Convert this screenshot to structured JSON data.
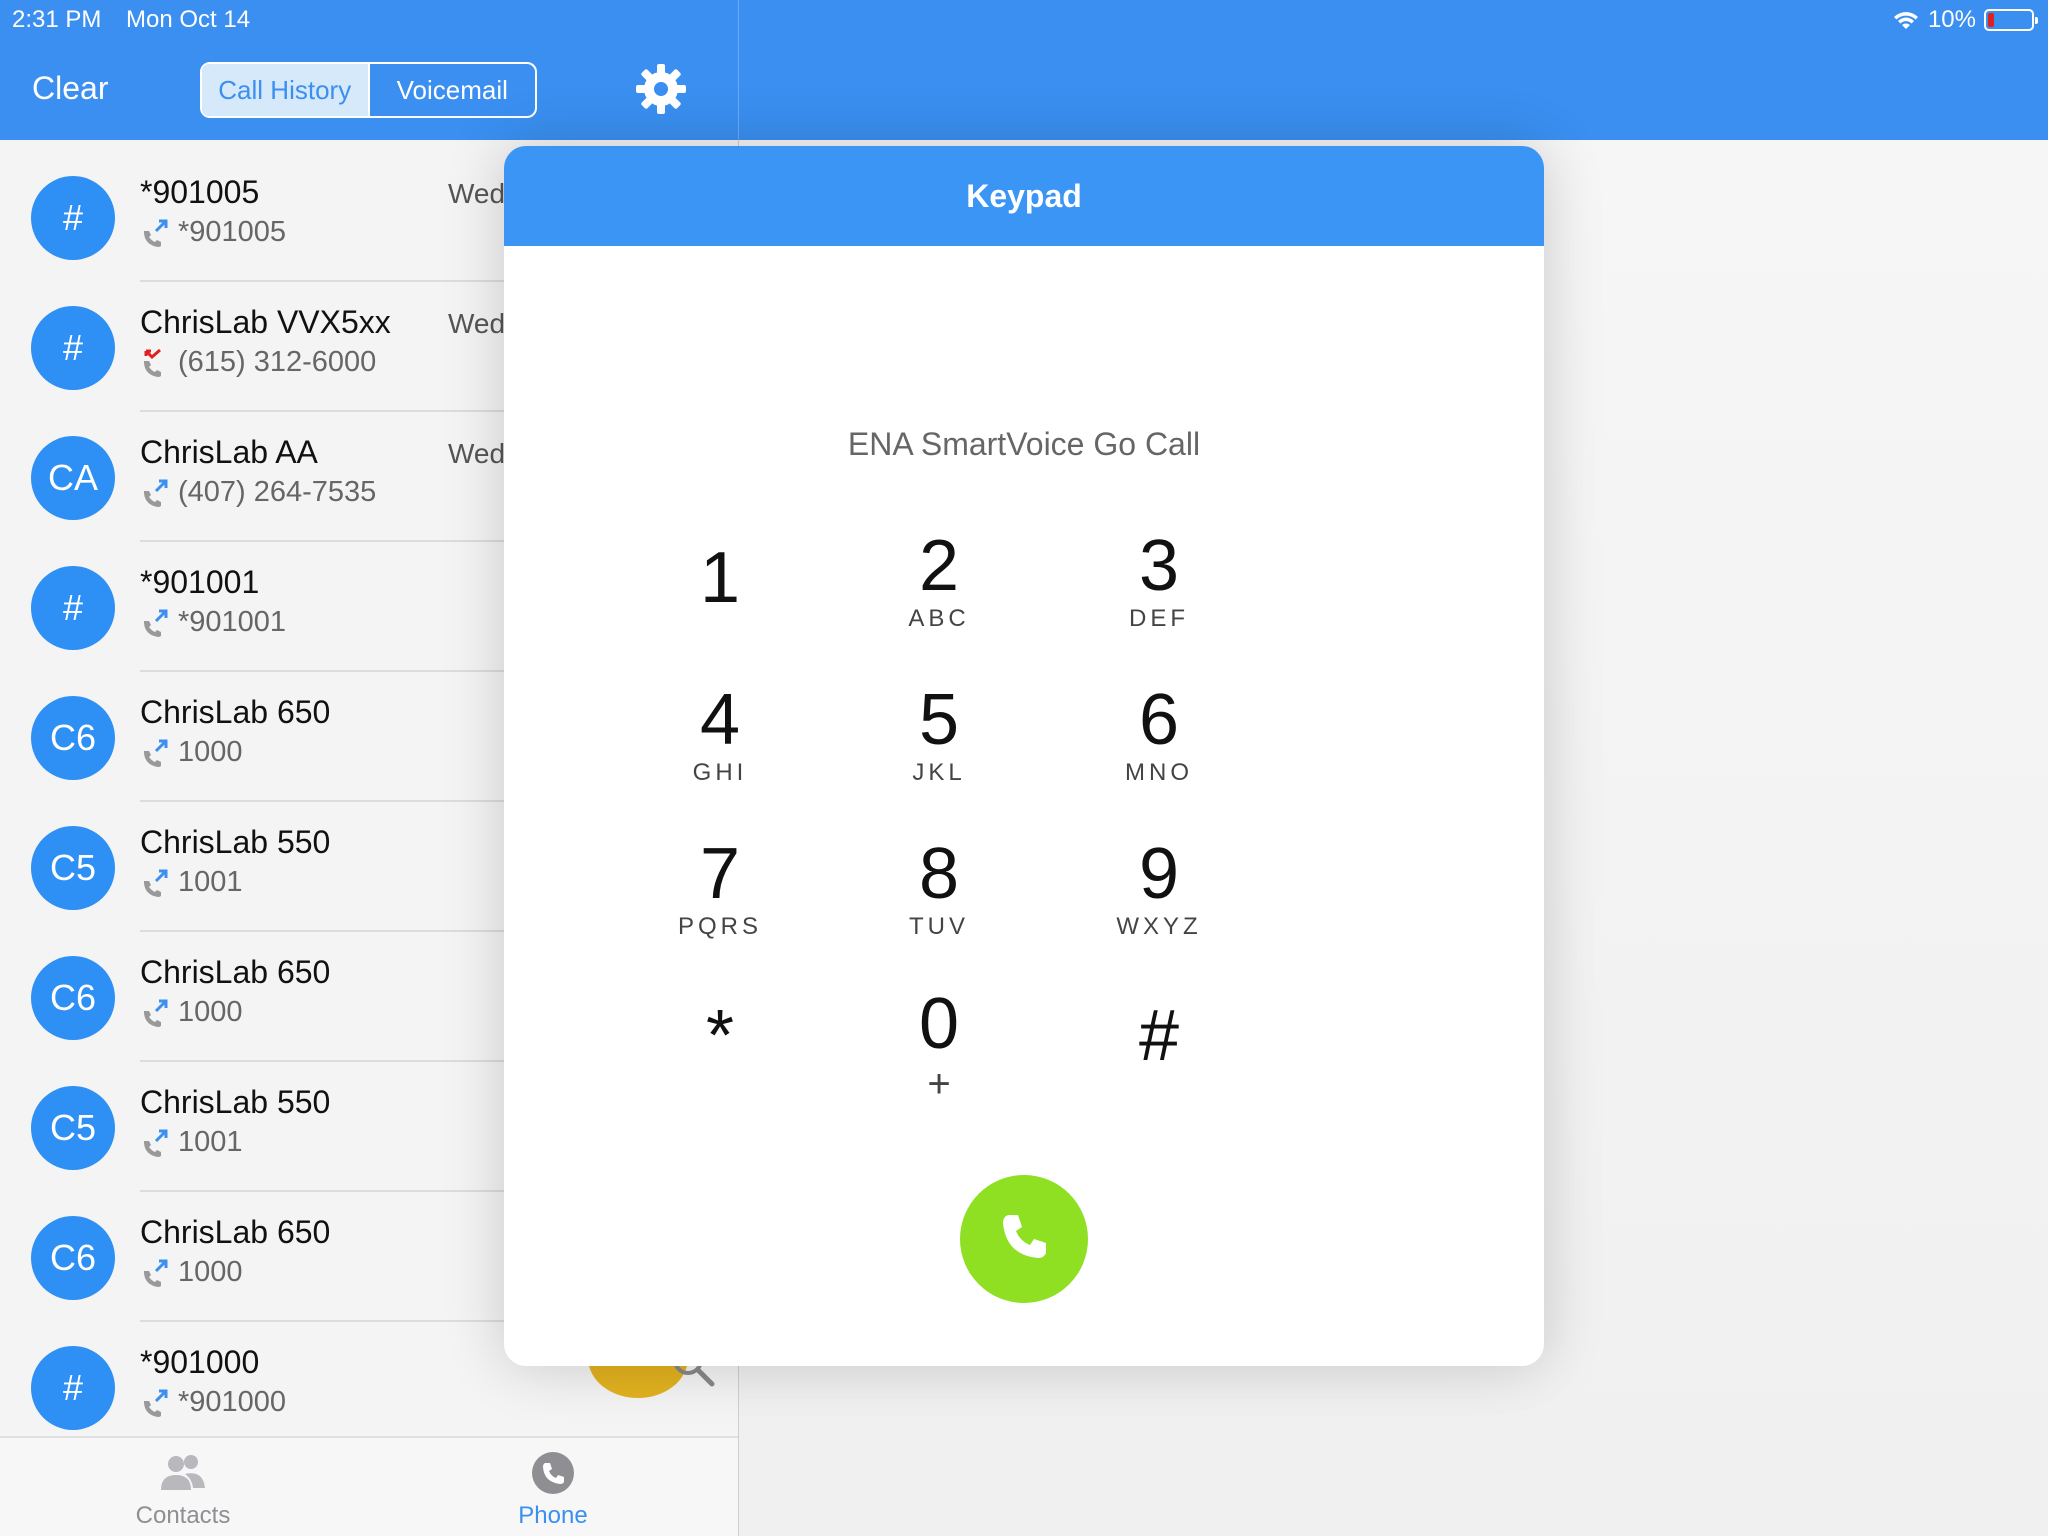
{
  "status_bar": {
    "time": "2:31 PM",
    "date": "Mon Oct 14",
    "battery": "10%"
  },
  "header": {
    "clear_label": "Clear",
    "tabs": [
      {
        "label": "Call History",
        "active": true
      },
      {
        "label": "Voicemail",
        "active": false
      }
    ]
  },
  "call_history": [
    {
      "avatar": "#",
      "name": "*901005",
      "number": "*901005",
      "date": "Wed",
      "call_type": "outgoing"
    },
    {
      "avatar": "#",
      "name": "ChrisLab VVX5xx",
      "number": "(615) 312-6000",
      "date": "Wed",
      "call_type": "missed"
    },
    {
      "avatar": "CA",
      "name": "ChrisLab AA",
      "number": "(407) 264-7535",
      "date": "Wed",
      "call_type": "outgoing"
    },
    {
      "avatar": "#",
      "name": "*901001",
      "number": "*901001",
      "date": "",
      "call_type": "outgoing"
    },
    {
      "avatar": "C6",
      "name": "ChrisLab 650",
      "number": "1000",
      "date": "",
      "call_type": "outgoing"
    },
    {
      "avatar": "C5",
      "name": "ChrisLab 550",
      "number": "1001",
      "date": "",
      "call_type": "outgoing"
    },
    {
      "avatar": "C6",
      "name": "ChrisLab 650",
      "number": "1000",
      "date": "",
      "call_type": "outgoing"
    },
    {
      "avatar": "C5",
      "name": "ChrisLab 550",
      "number": "1001",
      "date": "",
      "call_type": "outgoing"
    },
    {
      "avatar": "C6",
      "name": "ChrisLab 650",
      "number": "1000",
      "date": "",
      "call_type": "outgoing"
    },
    {
      "avatar": "#",
      "name": "*901000",
      "number": "*901000",
      "date": "",
      "call_type": "outgoing"
    }
  ],
  "bottom_tabs": [
    {
      "label": "Contacts",
      "icon": "contacts-icon",
      "active": false
    },
    {
      "label": "Phone",
      "icon": "phone-icon",
      "active": true
    }
  ],
  "keypad": {
    "title": "Keypad",
    "subtitle": "ENA SmartVoice Go Call",
    "keys": [
      {
        "digit": "1",
        "letters": ""
      },
      {
        "digit": "2",
        "letters": "ABC"
      },
      {
        "digit": "3",
        "letters": "DEF"
      },
      {
        "digit": "4",
        "letters": "GHI"
      },
      {
        "digit": "5",
        "letters": "JKL"
      },
      {
        "digit": "6",
        "letters": "MNO"
      },
      {
        "digit": "7",
        "letters": "PQRS"
      },
      {
        "digit": "8",
        "letters": "TUV"
      },
      {
        "digit": "9",
        "letters": "WXYZ"
      },
      {
        "digit": "*",
        "letters": ""
      },
      {
        "digit": "0",
        "letters": "+"
      },
      {
        "digit": "#",
        "letters": ""
      }
    ]
  },
  "colors": {
    "accent": "#3a8ff0",
    "avatar": "#2e8ff5",
    "call_button": "#8fe022",
    "missed": "#e02020"
  }
}
